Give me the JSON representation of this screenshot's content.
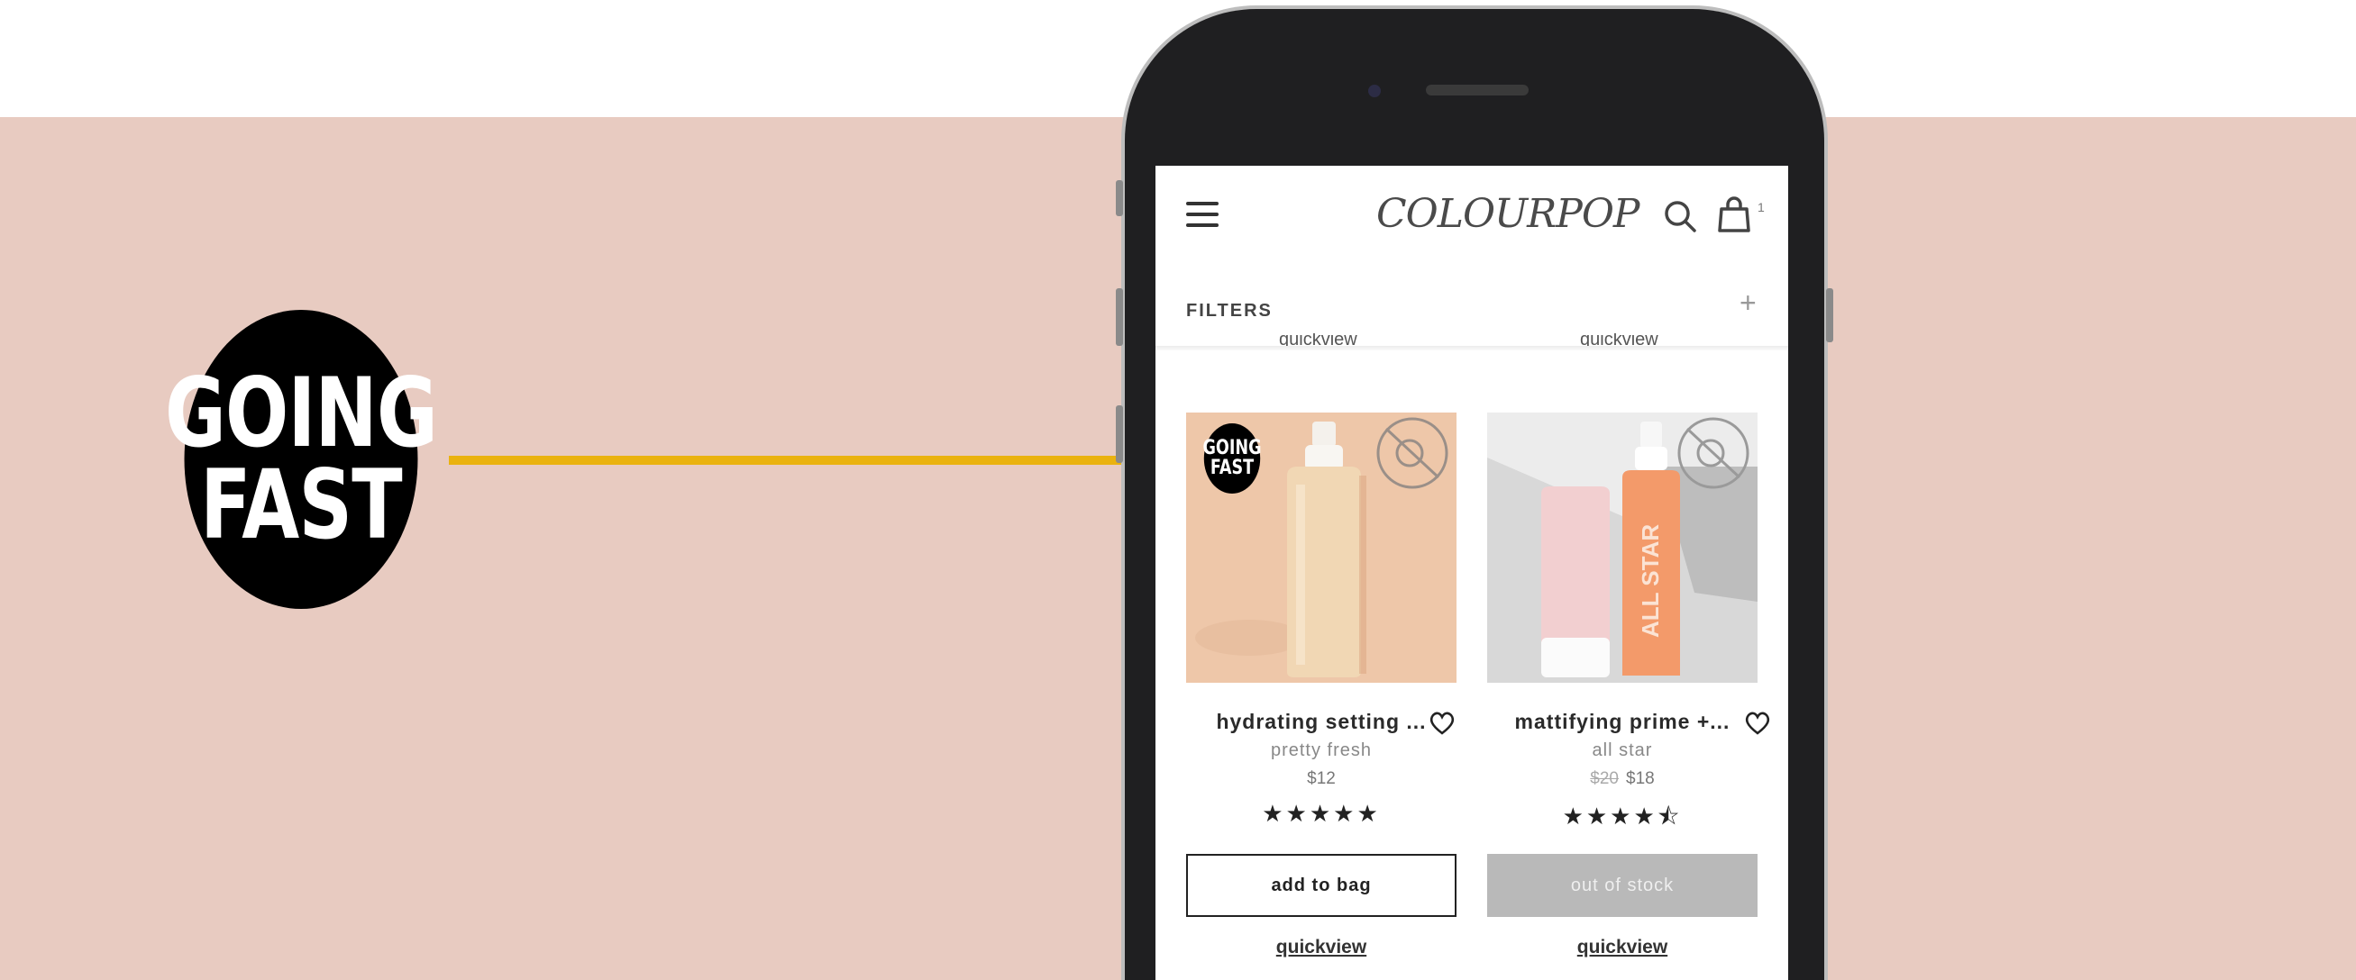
{
  "promo": {
    "badge_line1": "GOING",
    "badge_line2": "FAST"
  },
  "app": {
    "logo_text": "COLOURPOP",
    "cart_count": "1",
    "filters_label": "FILTERS",
    "filters_expand": "+",
    "quickview_label": "quickview"
  },
  "products": [
    {
      "name": "hydrating setting ...",
      "collection": "pretty fresh",
      "price": "$12",
      "original_price": "",
      "stars": "★★★★★",
      "rating": 5,
      "badge_line1": "GOING",
      "badge_line2": "FAST",
      "button_label": "add to bag"
    },
    {
      "name": "mattifying prime +...",
      "collection": "all star",
      "price": "$18",
      "original_price": "$20",
      "stars": "★★★★⯪",
      "rating": 4.5,
      "button_label": "out of stock"
    }
  ],
  "colors": {
    "backdrop": "#e8cbc1",
    "accent_line": "#eab20f",
    "badge": "#000000"
  }
}
